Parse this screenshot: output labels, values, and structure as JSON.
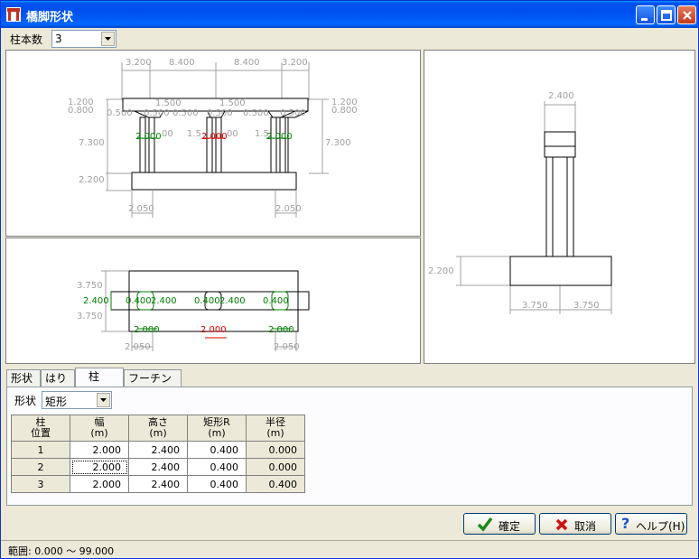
{
  "window": {
    "title": "橋脚形状"
  },
  "toolbar": {
    "column_count_label": "柱本数",
    "column_count_value": "3"
  },
  "front_view": {
    "top_dims": [
      "3.200",
      "8.400",
      "8.400",
      "3.200"
    ],
    "left_dims": [
      "1.200",
      "0.800",
      "7.300",
      "2.200"
    ],
    "right_dims": [
      "1.200",
      "0.800",
      "7.300"
    ],
    "haunch_dims": [
      "1.500",
      "1.500",
      "0.500",
      "0.500",
      "0.500",
      "0.500",
      "0.500",
      "0.500"
    ],
    "col_widths": [
      "2.000",
      "2.000",
      "2.000"
    ],
    "inner_dims": [
      "1.5",
      "1.5",
      "00",
      "00"
    ],
    "footing_dims": [
      "2.050",
      "2.050"
    ]
  },
  "plan_view": {
    "left_dims": [
      "3.750",
      "2.400",
      "3.750"
    ],
    "col_dims": [
      "0.400",
      "2.400",
      "0.400",
      "2.400",
      "0.400"
    ],
    "col_widths": [
      "2.000",
      "2.000",
      "2.000"
    ],
    "footing_dims": [
      "2.050",
      "2.050"
    ]
  },
  "side_view": {
    "top_dim": "2.400",
    "left_dim": "2.200",
    "bottom_dims": [
      "3.750",
      "3.750"
    ]
  },
  "tabs": [
    {
      "label": "形状"
    },
    {
      "label": "はり"
    },
    {
      "label": "柱"
    },
    {
      "label": "フーチング"
    }
  ],
  "column_tab": {
    "shape_label": "形状",
    "shape_value": "矩形",
    "headers": [
      "柱\n位置",
      "幅\n(m)",
      "高さ\n(m)",
      "矩形R\n(m)",
      "半径\n(m)"
    ],
    "rows": [
      {
        "pos": "1",
        "width": "2.000",
        "height": "2.400",
        "rect_r": "0.400",
        "radius": "0.000"
      },
      {
        "pos": "2",
        "width": "2.000",
        "height": "2.400",
        "rect_r": "0.400",
        "radius": "0.000"
      },
      {
        "pos": "3",
        "width": "2.000",
        "height": "2.400",
        "rect_r": "0.400",
        "radius": "0.400"
      }
    ]
  },
  "buttons": {
    "ok": "確定",
    "cancel": "取消",
    "help": "ヘルプ(H)"
  },
  "status": {
    "range": "範囲: 0.000 ～ 99.000"
  },
  "colors": {
    "dim_gray": "#a0a0a0",
    "selected_red": "#e00000",
    "col_green": "#008000",
    "titlebar": "#0053ee"
  }
}
